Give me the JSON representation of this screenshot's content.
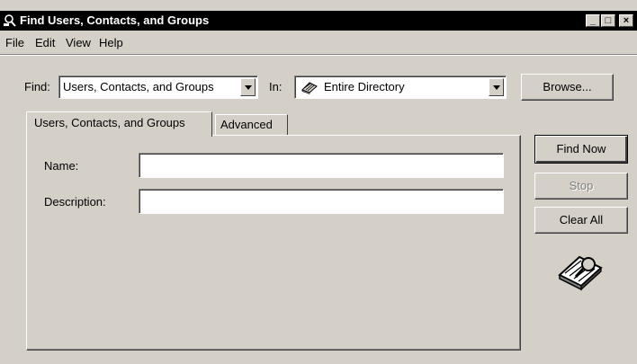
{
  "window": {
    "title": "Find Users, Contacts, and Groups",
    "controls": {
      "minimize": "_",
      "maximize": "□",
      "close": "×"
    }
  },
  "menu": [
    "File",
    "Edit",
    "View",
    "Help"
  ],
  "find": {
    "label": "Find:",
    "value": "Users, Contacts, and Groups",
    "in_label": "In:",
    "in_value": "Entire Directory",
    "in_icon": "directory-icon",
    "browse_label": "Browse..."
  },
  "tabs": [
    {
      "label": "Users, Contacts, and Groups",
      "active": true
    },
    {
      "label": "Advanced",
      "active": false
    }
  ],
  "form": {
    "name_label": "Name:",
    "name_value": "",
    "description_label": "Description:",
    "description_value": ""
  },
  "actions": {
    "find_now": "Find Now",
    "stop": "Stop",
    "clear_all": "Clear All",
    "search_icon": "search-animation-icon"
  }
}
